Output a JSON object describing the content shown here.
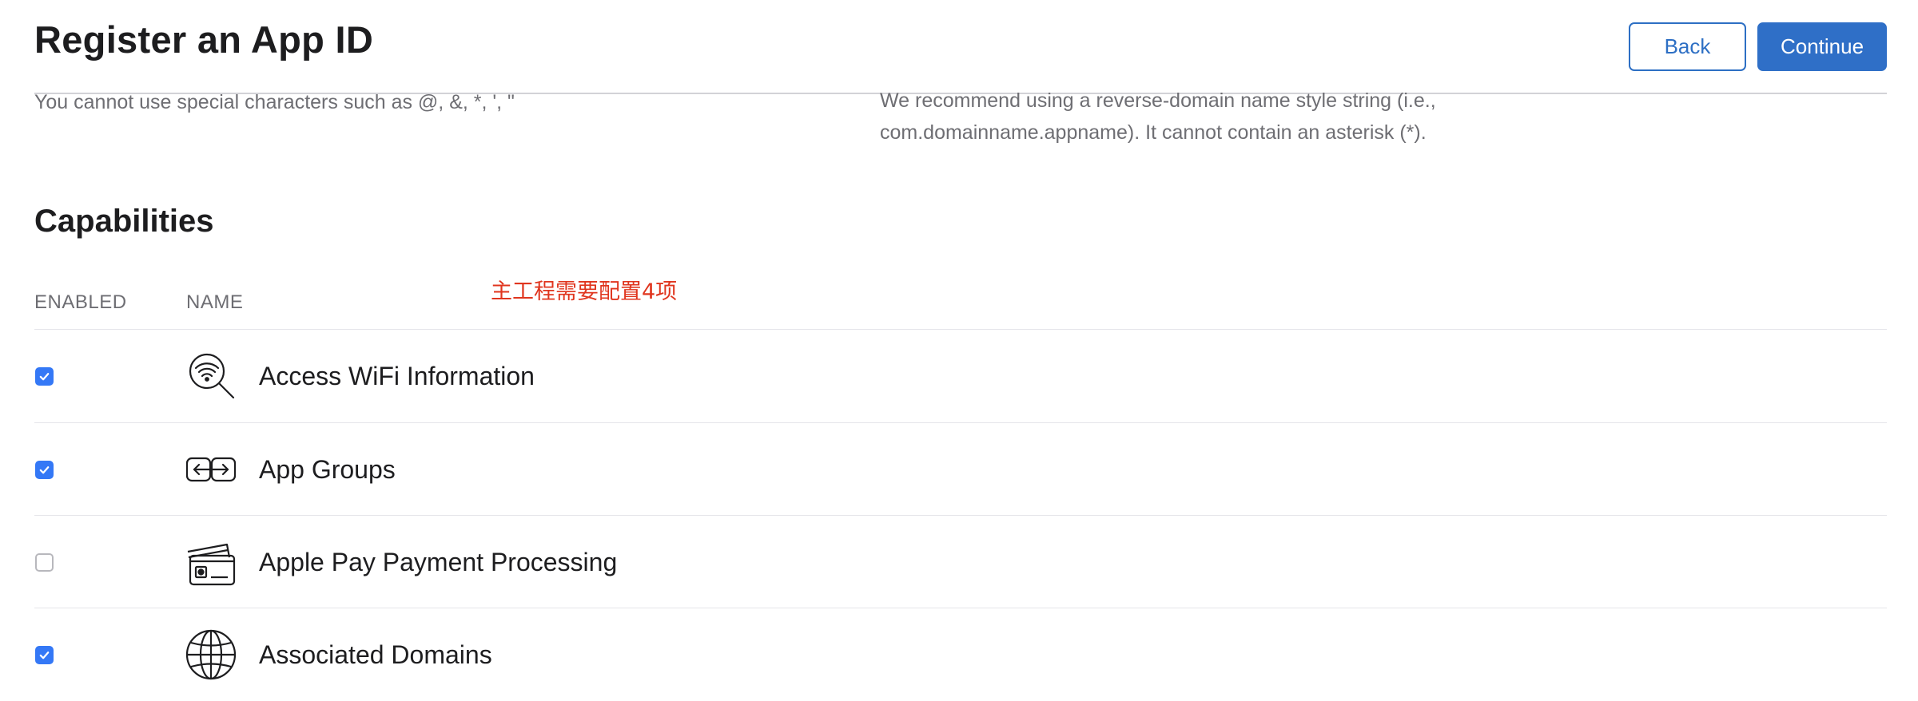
{
  "header": {
    "title": "Register an App ID",
    "back_label": "Back",
    "continue_label": "Continue"
  },
  "form_hints": {
    "description_hint": "You cannot use special characters such as @, &, *, ', \"",
    "bundle_id_hint": "We recommend using a reverse-domain name style string (i.e., com.domainname.appname). It cannot contain an asterisk (*)."
  },
  "capabilities": {
    "title": "Capabilities",
    "columns": {
      "enabled": "ENABLED",
      "name": "NAME"
    },
    "annotation": "主工程需要配置4项",
    "items": [
      {
        "name": "Access WiFi Information",
        "enabled": true,
        "icon": "wifi-search-icon"
      },
      {
        "name": "App Groups",
        "enabled": true,
        "icon": "app-groups-icon"
      },
      {
        "name": "Apple Pay Payment Processing",
        "enabled": false,
        "icon": "payment-cards-icon"
      },
      {
        "name": "Associated Domains",
        "enabled": true,
        "icon": "globe-icon"
      }
    ]
  },
  "colors": {
    "accent": "#2f6fc7",
    "checkbox": "#3478f6",
    "annotation": "#e0351e"
  }
}
